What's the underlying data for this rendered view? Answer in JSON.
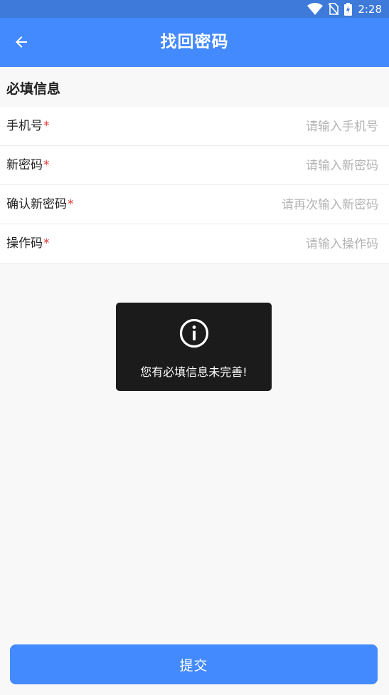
{
  "status_bar": {
    "time": "2:28"
  },
  "app_bar": {
    "title": "找回密码"
  },
  "section": {
    "title": "必填信息"
  },
  "form": {
    "required_mark": "*",
    "fields": [
      {
        "label": "手机号",
        "placeholder": "请输入手机号",
        "value": ""
      },
      {
        "label": "新密码",
        "placeholder": "请输入新密码",
        "value": ""
      },
      {
        "label": "确认新密码",
        "placeholder": "请再次输入新密码",
        "value": ""
      },
      {
        "label": "操作码",
        "placeholder": "请输入操作码",
        "value": ""
      }
    ]
  },
  "toast": {
    "icon": "info-icon",
    "message": "您有必填信息未完善!"
  },
  "submit": {
    "label": "提交"
  },
  "colors": {
    "accent": "#448aff",
    "status_bar": "#3d7ad9",
    "required": "#e53935",
    "toast_bg": "#1b1b1b",
    "background": "#f8f8f8"
  }
}
